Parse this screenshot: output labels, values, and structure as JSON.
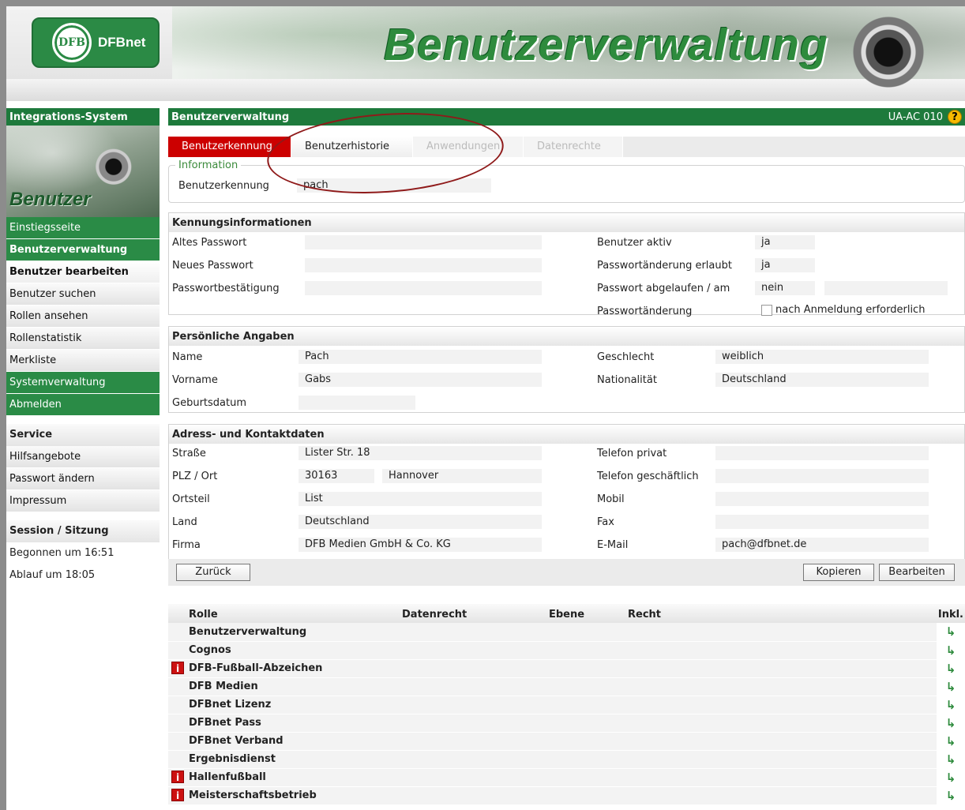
{
  "header": {
    "logo_text": "DFBnet",
    "logo_badge": "DFB",
    "banner_title": "Benutzerverwaltung"
  },
  "sidebar": {
    "system_title": "Integrations-System",
    "photo_label": "Benutzer",
    "nav": [
      {
        "label": "Einstiegsseite"
      },
      {
        "label": "Benutzerverwaltung"
      },
      {
        "label": "Benutzer bearbeiten"
      },
      {
        "label": "Benutzer suchen"
      },
      {
        "label": "Rollen ansehen"
      },
      {
        "label": "Rollenstatistik"
      },
      {
        "label": "Merkliste"
      },
      {
        "label": "Systemverwaltung"
      },
      {
        "label": "Abmelden"
      }
    ],
    "service": {
      "title": "Service",
      "items": [
        "Hilfsangebote",
        "Passwort ändern",
        "Impressum"
      ]
    },
    "session": {
      "title": "Session / Sitzung",
      "started": "Begonnen um 16:51",
      "expires": "Ablauf um 18:05"
    }
  },
  "main": {
    "title": "Benutzerverwaltung",
    "page_code": "UA-AC 010",
    "help_glyph": "?",
    "tabs": [
      "Benutzerkennung",
      "Benutzerhistorie",
      "Anwendungen",
      "Datenrechte"
    ],
    "info": {
      "legend": "Information",
      "label": "Benutzerkennung",
      "value": "pach"
    },
    "kennung": {
      "title": "Kennungsinformationen",
      "altes_passwort": "Altes Passwort",
      "neues_passwort": "Neues Passwort",
      "passwortbestaetigung": "Passwortbestätigung",
      "benutzer_aktiv_label": "Benutzer aktiv",
      "benutzer_aktiv": "ja",
      "pw_aenderung_erlaubt_label": "Passwortänderung erlaubt",
      "pw_aenderung_erlaubt": "ja",
      "pw_abgelaufen_label": "Passwort abgelaufen / am",
      "pw_abgelaufen": "nein",
      "pw_aenderung_label": "Passwortänderung",
      "pw_aenderung_checkbox": "nach Anmeldung erforderlich"
    },
    "personal": {
      "title": "Persönliche Angaben",
      "name_label": "Name",
      "name": "Pach",
      "vorname_label": "Vorname",
      "vorname": "Gabs",
      "geburtsdatum_label": "Geburtsdatum",
      "geschlecht_label": "Geschlecht",
      "geschlecht": "weiblich",
      "nationalitaet_label": "Nationalität",
      "nationalitaet": "Deutschland"
    },
    "address": {
      "title": "Adress- und Kontaktdaten",
      "strasse_label": "Straße",
      "strasse": "Lister Str. 18",
      "plz_label": "PLZ / Ort",
      "plz": "30163",
      "ort": "Hannover",
      "ortsteil_label": "Ortsteil",
      "ortsteil": "List",
      "land_label": "Land",
      "land": "Deutschland",
      "firma_label": "Firma",
      "firma": "DFB Medien GmbH & Co. KG",
      "tel_privat_label": "Telefon privat",
      "tel_geschaeft_label": "Telefon geschäftlich",
      "mobil_label": "Mobil",
      "fax_label": "Fax",
      "email_label": "E-Mail",
      "email": "pach@dfbnet.de"
    },
    "buttons": {
      "back": "Zurück",
      "copy": "Kopieren",
      "edit": "Bearbeiten"
    },
    "roles_table": {
      "headers": [
        "Rolle",
        "Datenrecht",
        "Ebene",
        "Recht",
        "Inkl."
      ],
      "rows": [
        {
          "name": "Benutzerverwaltung",
          "info": false
        },
        {
          "name": "Cognos",
          "info": false
        },
        {
          "name": "DFB-Fußball-Abzeichen",
          "info": true
        },
        {
          "name": "DFB Medien",
          "info": false
        },
        {
          "name": "DFBnet Lizenz",
          "info": false
        },
        {
          "name": "DFBnet Pass",
          "info": false
        },
        {
          "name": "DFBnet Verband",
          "info": false
        },
        {
          "name": "Ergebnisdienst",
          "info": false
        },
        {
          "name": "Hallenfußball",
          "info": true
        },
        {
          "name": "Meisterschaftsbetrieb",
          "info": true
        }
      ],
      "info_glyph": "i",
      "arrow_glyph": "↳"
    }
  }
}
